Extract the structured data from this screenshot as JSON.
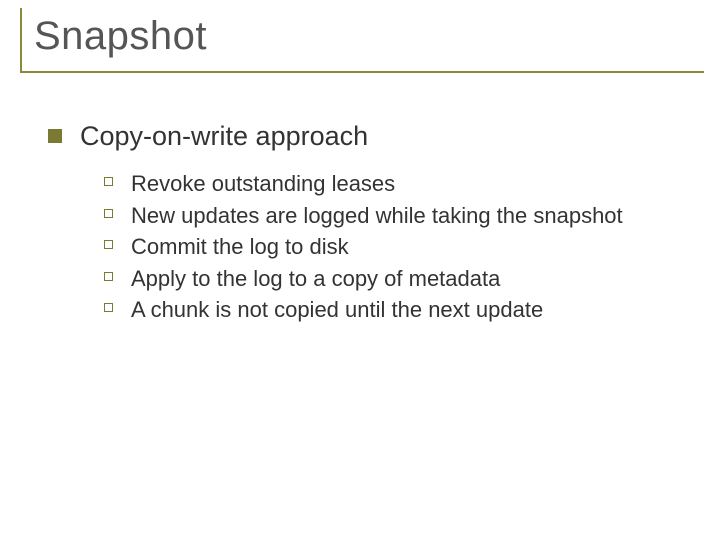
{
  "slide": {
    "title": "Snapshot",
    "points": [
      {
        "text": "Copy-on-write approach",
        "sub": [
          "Revoke outstanding leases",
          "New updates are logged while taking the snapshot",
          "Commit the log to disk",
          "Apply to the log to a copy of metadata",
          "A chunk is not copied until the next update"
        ]
      }
    ]
  }
}
